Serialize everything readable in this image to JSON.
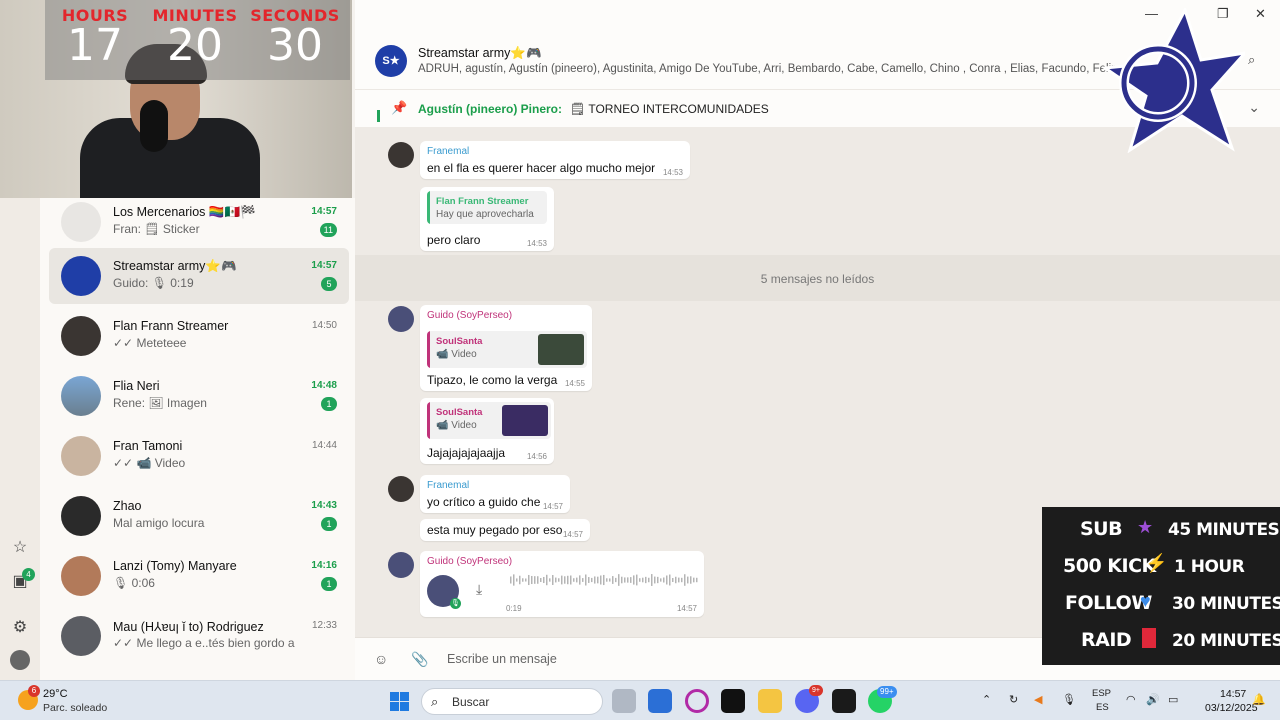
{
  "timer": {
    "hours_label": "HOURS",
    "hours": "17",
    "minutes_label": "MINUTES",
    "minutes": "20",
    "seconds_label": "SECONDS",
    "seconds": "30"
  },
  "rail": {
    "archive_badge": "4"
  },
  "chats": [
    {
      "name": "Los Mercenarios 🏳️‍🌈🇲🇽🏁",
      "preview": "Fran: 🗒 Sticker",
      "time": "14:57",
      "unread": "11"
    },
    {
      "name": "Streamstar army⭐🎮",
      "preview": "Guido: 🎙 0:19",
      "time": "14:57",
      "unread": "5"
    },
    {
      "name": "Flan Frann Streamer",
      "preview": "✓✓ Meteteee",
      "time": "14:50",
      "unread": ""
    },
    {
      "name": "Flia Neri",
      "preview": "Rene: 🖼 Imagen",
      "time": "14:48",
      "unread": "1"
    },
    {
      "name": "Fran Tamoni",
      "preview": "✓✓ 📹 Video",
      "time": "14:44",
      "unread": ""
    },
    {
      "name": "Zhao",
      "preview": "Mal amigo locura",
      "time": "14:43",
      "unread": "1"
    },
    {
      "name": "Lanzi (Tomy) Manyare",
      "preview": "🎙 0:06",
      "time": "14:16",
      "unread": "1"
    },
    {
      "name": "Mau (H⅄ɐuꞁ ǐ to) Rodriguez",
      "preview": "✓✓ Me llego a e..tés bien gordo a",
      "time": "12:33",
      "unread": ""
    }
  ],
  "header": {
    "avatar": "S★",
    "title": "Streamstar army⭐🎮",
    "members": "ADRUH, agustín, Agustín (pineero), Agustinita, Amigo De YouTube, Arri, Bembardo, Cabe, Camello, Chino , Conra , Elias, Facundo, Felipe"
  },
  "pinned": {
    "author": "Agustín (pineero) Pinero:",
    "text": "🗒 TORNEO INTERCOMUNIDADES"
  },
  "messages": {
    "m1": {
      "sender": "Franemal",
      "text": "en el fla es querer hacer algo mucho mejor",
      "time": "14:53"
    },
    "m2": {
      "quote_name": "Flan Frann Streamer",
      "quote_text": "Hay que aprovecharla",
      "text": "pero claro",
      "time": "14:53"
    },
    "unread_label": "5 mensajes no leídos",
    "m3": {
      "sender": "Guido (SoyPerseo)",
      "quote_name": "SoulSanta",
      "quote_text": "📹 Video",
      "text": "Tipazo, le como la verga",
      "time": "14:55"
    },
    "m4": {
      "quote_name": "SoulSanta",
      "quote_text": "📹 Video",
      "text": "Jajajajajajaajja",
      "time": "14:56"
    },
    "m5": {
      "sender": "Franemal",
      "text": "yo crítico a guido che",
      "time": "14:57"
    },
    "m6": {
      "text": "esta muy pegado por eso",
      "time": "14:57"
    },
    "m7": {
      "sender": "Guido (SoyPerseo)",
      "duration": "0:19",
      "time": "14:57"
    }
  },
  "composer": {
    "placeholder": "Escribe un mensaje"
  },
  "overlay": {
    "rows": [
      {
        "key": "SUB",
        "emoji": "💜",
        "value": "45 MINUTES"
      },
      {
        "key": "500 KICK",
        "emoji": "⚡",
        "value": "1 HOUR"
      },
      {
        "key": "FOLLOW",
        "emoji": "💙",
        "value": "30 MINUTES"
      },
      {
        "key": "RAID",
        "emoji": "🔖",
        "value": "20 MINUTES"
      }
    ]
  },
  "taskbar": {
    "weather_temp": "29°C",
    "weather_desc": "Parc. soleado",
    "weather_badge": "6",
    "search_placeholder": "Buscar",
    "whatsapp_badge": "99+",
    "discord_badge": "9+",
    "lang_top": "ESP",
    "lang_bottom": "ES",
    "time": "14:57",
    "date": "03/12/2025"
  }
}
